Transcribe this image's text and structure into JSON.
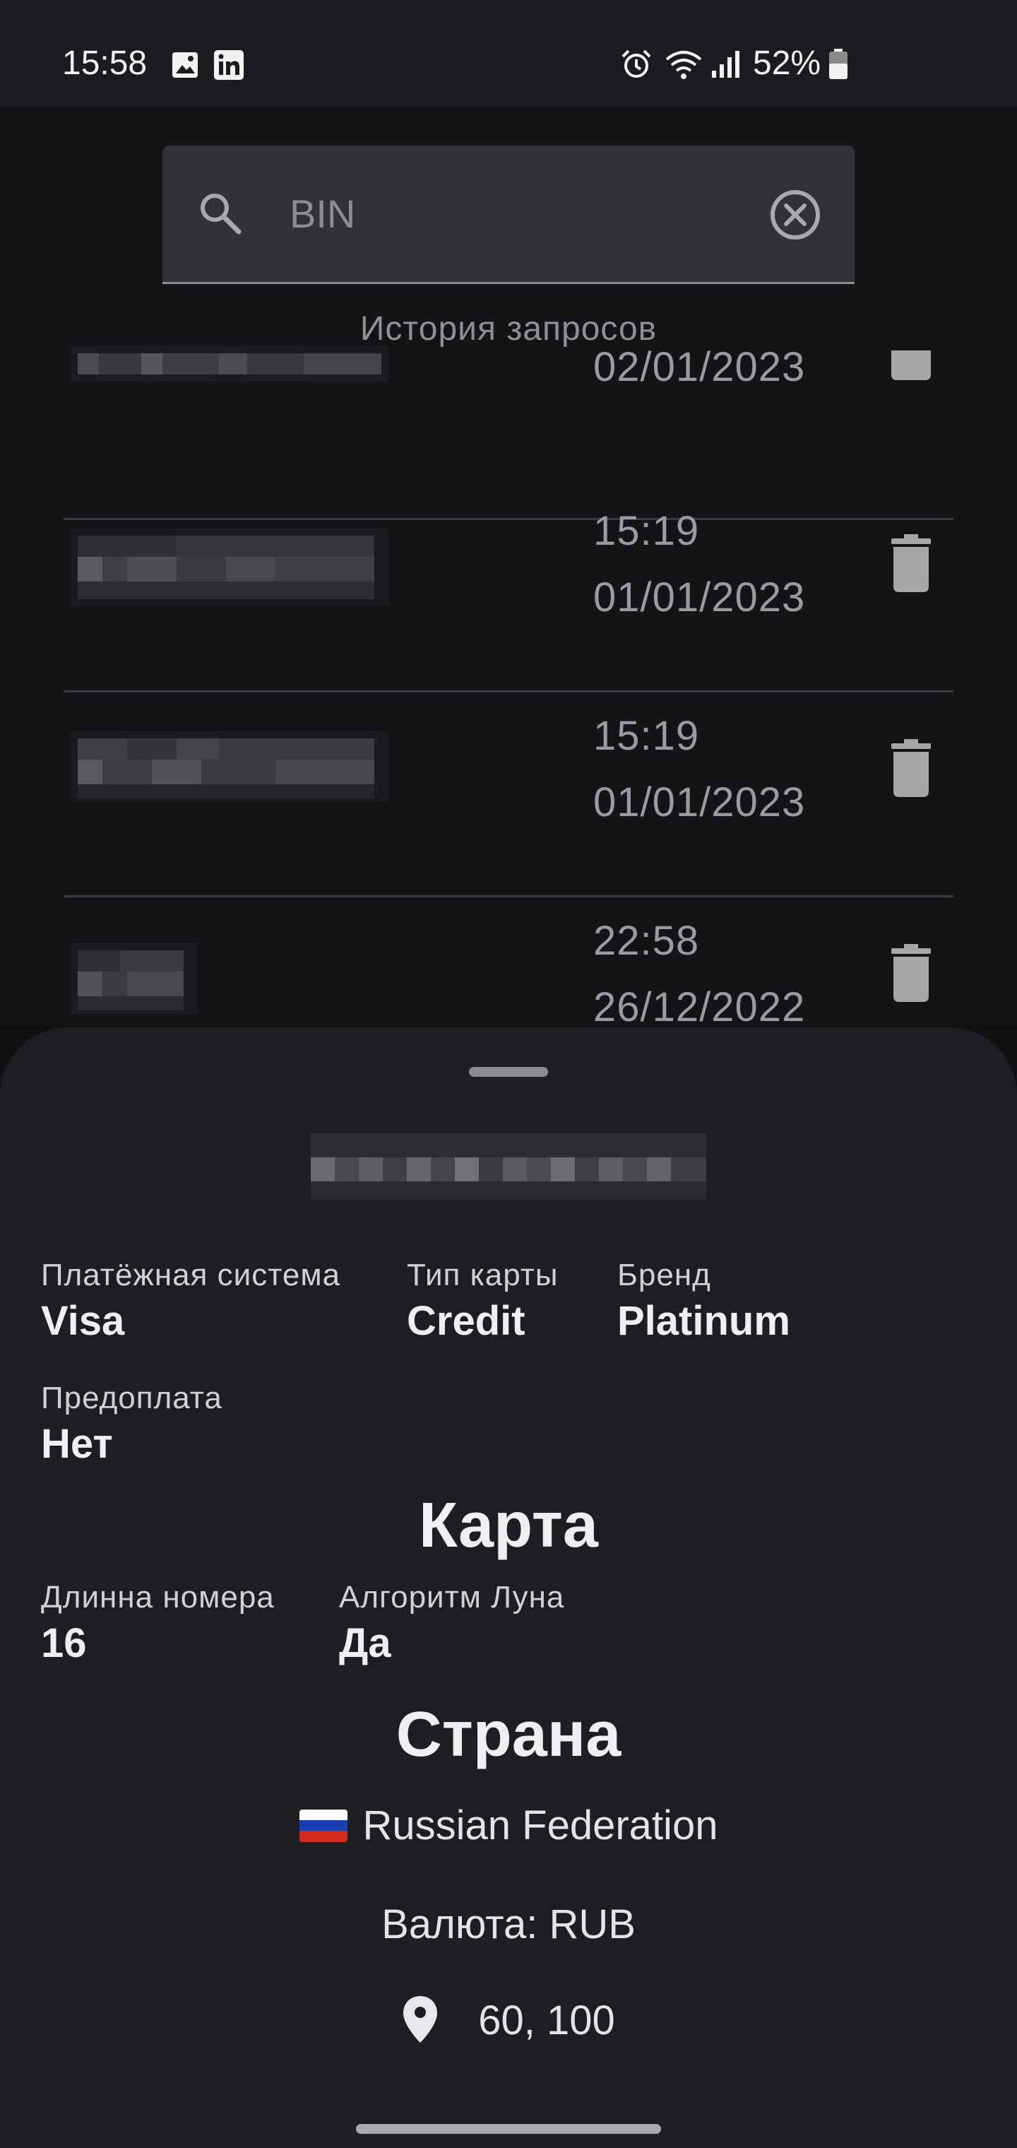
{
  "status_bar": {
    "time": "15:58",
    "battery": "52%",
    "icons": [
      "image-icon",
      "linkedin-icon",
      "alarm-icon",
      "wifi-icon",
      "signal-icon",
      "battery-icon"
    ]
  },
  "search": {
    "placeholder": "BIN",
    "search_icon": "search-icon",
    "clear_icon": "clear-icon"
  },
  "history": {
    "title": "История запросов",
    "items": [
      {
        "time": "",
        "date": "02/01/2023"
      },
      {
        "time": "15:19",
        "date": "01/01/2023"
      },
      {
        "time": "15:19",
        "date": "01/01/2023"
      },
      {
        "time": "22:58",
        "date": "26/12/2022"
      }
    ]
  },
  "details": {
    "scheme_label": "Платёжная система",
    "scheme_value": "Visa",
    "type_label": "Тип карты",
    "type_value": "Credit",
    "brand_label": "Бренд",
    "brand_value": "Platinum",
    "prepaid_label": "Предоплата",
    "prepaid_value": "Нет",
    "card_title": "Карта",
    "length_label": "Длинна номера",
    "length_value": "16",
    "luhn_label": "Алгоритм Луна",
    "luhn_value": "Да",
    "country_title": "Страна",
    "country_name": "Russian Federation",
    "currency": "Валюта: RUB",
    "coordinates": "60, 100"
  },
  "colors": {
    "background": "#111114",
    "sheet": "#1e1e22",
    "search_field": "#313136"
  }
}
